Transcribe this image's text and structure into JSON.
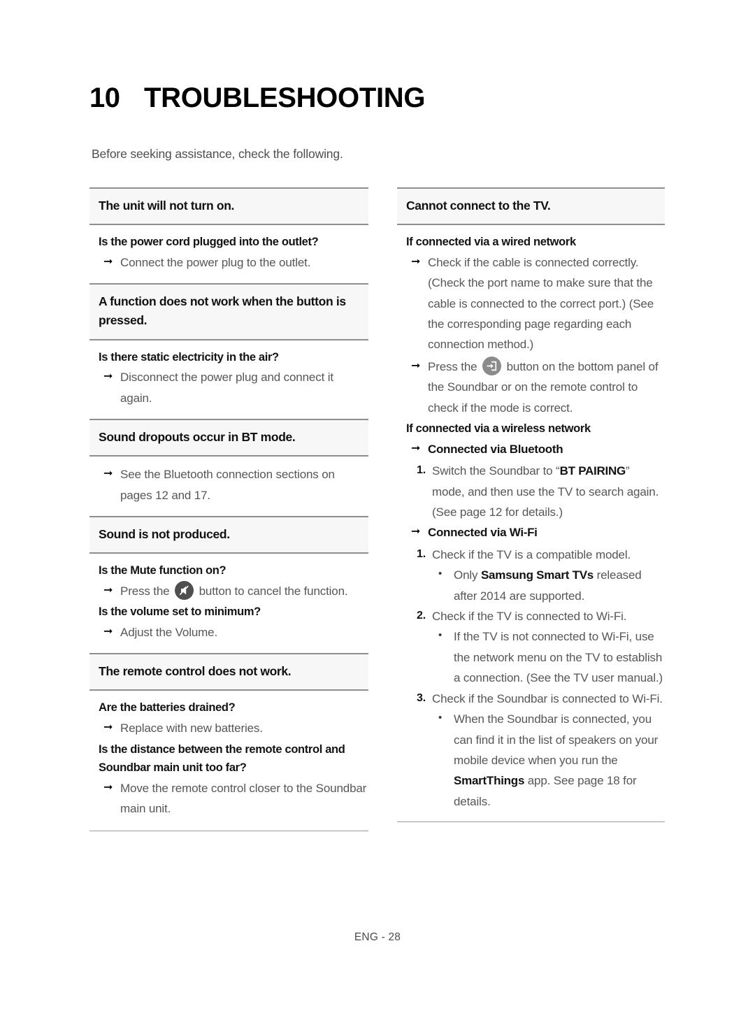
{
  "title": {
    "number": "10",
    "text": "TROUBLESHOOTING"
  },
  "intro": "Before seeking assistance, check the following.",
  "footer": "ENG - 28",
  "icons": {
    "mute": "mute-button-icon",
    "source": "source-button-icon",
    "arrow": "➞",
    "bullet": "•"
  },
  "colors": {
    "rule": "#8e8e8e",
    "header_band": "#f7f7f7",
    "body_text": "#575757",
    "heading_text": "#131313",
    "mute_button": "#4f4f4f",
    "source_button": "#8b8b8b"
  },
  "left_column": {
    "sections": [
      {
        "header": "The unit will not turn on.",
        "items": [
          {
            "type": "question",
            "text": "Is the power cord plugged into the outlet?"
          },
          {
            "type": "answer",
            "text": "Connect the power plug to the outlet."
          }
        ]
      },
      {
        "header": "A function does not work when the button is pressed.",
        "items": [
          {
            "type": "question",
            "text": "Is there static electricity in the air?"
          },
          {
            "type": "answer",
            "text": "Disconnect the power plug and connect it again."
          }
        ]
      },
      {
        "header": "Sound dropouts occur in BT mode.",
        "items": [
          {
            "type": "answer",
            "text": "See the Bluetooth connection sections on pages 12 and 17."
          }
        ]
      },
      {
        "header": "Sound is not produced.",
        "items": [
          {
            "type": "question",
            "text": "Is the Mute function on?"
          },
          {
            "type": "answer_icon",
            "before": "Press the",
            "icon": "mute",
            "after": "button to cancel the function."
          },
          {
            "type": "question",
            "text": "Is the volume set to minimum?"
          },
          {
            "type": "answer",
            "text": "Adjust the Volume."
          }
        ]
      },
      {
        "header": "The remote control does not work.",
        "items": [
          {
            "type": "question",
            "text": "Are the batteries drained?"
          },
          {
            "type": "answer",
            "text": "Replace with new batteries."
          },
          {
            "type": "question",
            "text": "Is the distance between the remote control and Soundbar main unit too far?"
          },
          {
            "type": "answer",
            "text": "Move the remote control closer to the Soundbar main unit."
          }
        ]
      }
    ]
  },
  "right_column": {
    "sections": [
      {
        "header": "Cannot connect to the TV.",
        "items": [
          {
            "type": "question",
            "text": "If connected via a wired network"
          },
          {
            "type": "answer",
            "text": "Check if the cable is connected correctly. (Check the port name to make sure that the cable is connected to the correct port.) (See the corresponding page regarding each connection method.)"
          },
          {
            "type": "answer_icon",
            "before": "Press the",
            "icon": "source",
            "after": "button on the bottom panel of the Soundbar or on the remote control to check if the mode is correct."
          },
          {
            "type": "question",
            "text": "If connected via a wireless network"
          },
          {
            "type": "answer_bold",
            "text": "Connected via Bluetooth"
          },
          {
            "type": "numbered",
            "mark": "1.",
            "parts": [
              {
                "t": "Switch the Soundbar to “"
              },
              {
                "t": "BT PAIRING",
                "bold": true
              },
              {
                "t": "” mode, and then use the TV to search again. (See page 12 for details.)"
              }
            ]
          },
          {
            "type": "answer_bold",
            "text": "Connected via Wi-Fi"
          },
          {
            "type": "numbered",
            "mark": "1.",
            "parts": [
              {
                "t": "Check if the TV is a compatible model."
              }
            ]
          },
          {
            "type": "bullet",
            "parts": [
              {
                "t": "Only "
              },
              {
                "t": "Samsung Smart TVs",
                "bold": true
              },
              {
                "t": " released after 2014 are supported."
              }
            ]
          },
          {
            "type": "numbered",
            "mark": "2.",
            "parts": [
              {
                "t": "Check if the TV is connected to Wi-Fi."
              }
            ]
          },
          {
            "type": "bullet",
            "parts": [
              {
                "t": "If the TV is not connected to Wi-Fi, use the network menu on the TV to establish a connection. (See the TV user manual.)"
              }
            ]
          },
          {
            "type": "numbered",
            "mark": "3.",
            "parts": [
              {
                "t": "Check if the Soundbar is connected to Wi-Fi."
              }
            ]
          },
          {
            "type": "bullet",
            "parts": [
              {
                "t": "When the Soundbar is connected, you can find it in the list of speakers on your mobile device when you run the "
              },
              {
                "t": "SmartThings",
                "bold": true
              },
              {
                "t": " app. See page 18 for details."
              }
            ]
          }
        ]
      }
    ]
  }
}
